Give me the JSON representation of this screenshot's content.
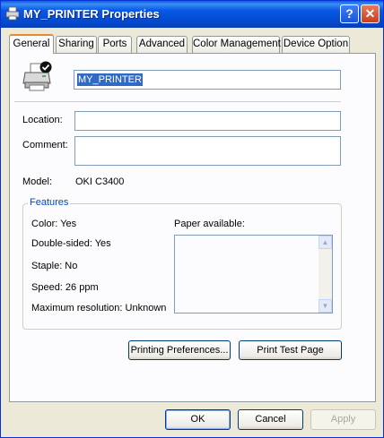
{
  "window": {
    "title": "MY_PRINTER Properties",
    "help_glyph": "?",
    "close_glyph": "✕"
  },
  "tabs": [
    "General",
    "Sharing",
    "Ports",
    "Advanced",
    "Color Management",
    "Device Option"
  ],
  "general": {
    "printer_name": "MY_PRINTER",
    "location_label": "Location:",
    "location_value": "",
    "comment_label": "Comment:",
    "comment_value": "",
    "model_label": "Model:",
    "model_value": "OKI C3400"
  },
  "features": {
    "title": "Features",
    "color": "Color: Yes",
    "double_sided": "Double-sided: Yes",
    "staple": "Staple: No",
    "speed": "Speed: 26 ppm",
    "max_resolution": "Maximum resolution: Unknown",
    "paper_available_label": "Paper available:",
    "paper_available_items": []
  },
  "buttons": {
    "printing_preferences": "Printing Preferences...",
    "print_test_page": "Print Test Page",
    "ok": "OK",
    "cancel": "Cancel",
    "apply": "Apply"
  },
  "icons": {
    "title": "printer-icon",
    "printer_large": "printer-icon",
    "default_check": "default-printer-check-icon"
  },
  "colors": {
    "titlebar": "#0858e6",
    "tab_highlight": "#e68b2c",
    "selection": "#316ac5",
    "group_title": "#0046d5"
  }
}
